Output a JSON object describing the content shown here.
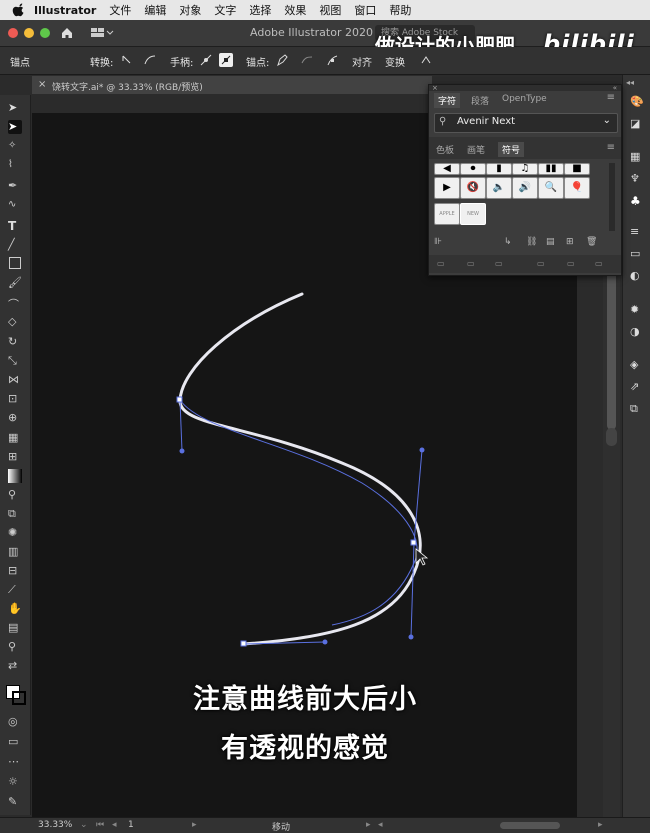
{
  "menubar": {
    "app_name": "Illustrator",
    "items": [
      "文件",
      "编辑",
      "对象",
      "文字",
      "选择",
      "效果",
      "视图",
      "窗口",
      "帮助"
    ]
  },
  "window": {
    "title": "Adobe Illustrator 2020",
    "search_placeholder": "搜索 Adobe Stock"
  },
  "watermark": {
    "uploader": "做设计的小肥肥",
    "logo": "bilibili"
  },
  "control_bar": {
    "anchor_label": "锚点",
    "convert_label": "转换:",
    "handle_label": "手柄:",
    "anchor_point_label": "锚点:",
    "align_label": "对齐",
    "transform_label": "变换"
  },
  "document_tab": {
    "close": "×",
    "name": "饶转文字.ai* @ 33.33% (RGB/预览)"
  },
  "panel": {
    "top_tabs": [
      "字符",
      "段落",
      "OpenType"
    ],
    "font_name": "Avenir Next",
    "swatch_tabs": [
      "色板",
      "画笔",
      "符号"
    ],
    "active_swatch_tab": "符号",
    "symbols": [
      "◀",
      "⏺",
      "▮",
      "♫",
      "▮▮",
      "■",
      "▶",
      "🔇",
      "🔈",
      "🔊",
      "🔍",
      "🎈"
    ],
    "symbol_thumbs": [
      "APPLE",
      "NEW"
    ]
  },
  "status_bar": {
    "zoom": "33.33%",
    "page": "1",
    "tool_status": "移动"
  },
  "subtitles": {
    "line1": "注意曲线前大后小",
    "line2": "有透视的感觉"
  },
  "colors": {
    "canvas": "#151515",
    "path_stroke": "#e8e8f0",
    "selection_blue": "#4a62d8"
  }
}
